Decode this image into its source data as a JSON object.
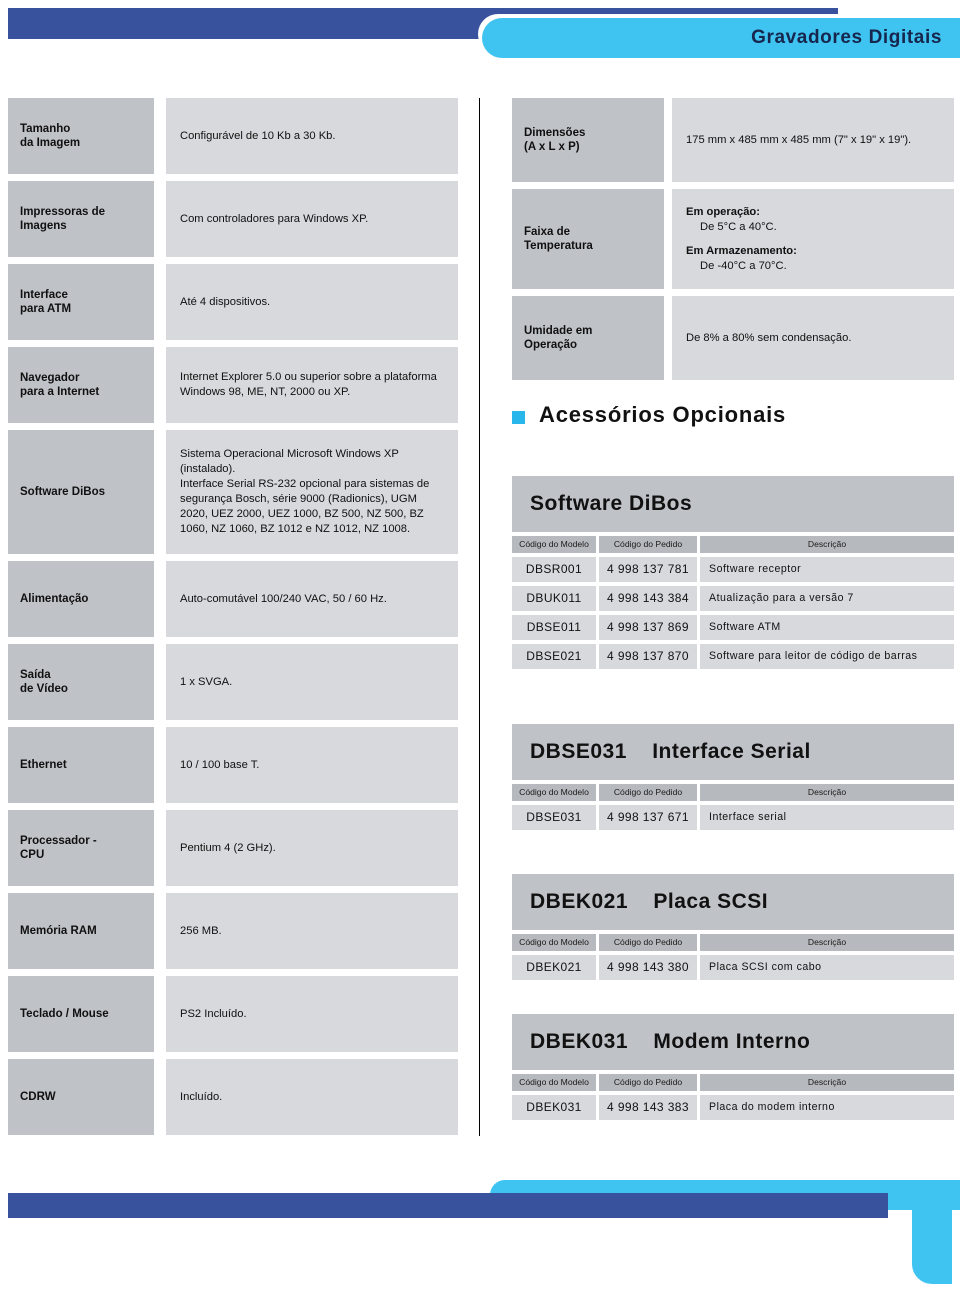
{
  "header": {
    "title": "Gravadores Digitais",
    "accent_dark": "#39529e",
    "accent_light": "#3fc3f0"
  },
  "spec_left": {
    "rows": [
      {
        "label": "Tamanho\nda Imagem",
        "value": "Configurável de 10 Kb a 30 Kb."
      },
      {
        "label": "Impressoras de\nImagens",
        "value": "Com controladores para Windows XP."
      },
      {
        "label": "Interface\npara ATM",
        "value": "Até 4 dispositivos."
      },
      {
        "label": "Navegador\npara a Internet",
        "value": "Internet Explorer 5.0 ou superior sobre a plataforma Windows 98, ME, NT, 2000 ou XP."
      },
      {
        "label": "Software DiBos",
        "value": "Sistema Operacional Microsoft Windows XP (instalado).\nInterface Serial RS-232 opcional para sistemas de segurança Bosch, série 9000 (Radionics), UGM 2020, UEZ 2000, UEZ 1000, BZ 500, NZ 500, BZ 1060, NZ 1060, BZ 1012 e NZ 1012, NZ 1008."
      },
      {
        "label": "Alimentação",
        "value": "Auto-comutável 100/240 VAC, 50 / 60 Hz."
      },
      {
        "label": "Saída\nde Vídeo",
        "value": "1 x SVGA."
      },
      {
        "label": "Ethernet",
        "value": "10 / 100 base T."
      },
      {
        "label": "Processador -\nCPU",
        "value": "Pentium 4 (2 GHz)."
      },
      {
        "label": "Memória RAM",
        "value": "256 MB."
      },
      {
        "label": "Teclado / Mouse",
        "value": "PS2 Incluído."
      },
      {
        "label": "CDRW",
        "value": "Incluído."
      }
    ]
  },
  "spec_right": {
    "rows": [
      {
        "label": "Dimensões\n(A x L x P)",
        "value": "175 mm x 485 mm x 485 mm (7\" x 19\" x 19\")."
      },
      {
        "label": "Faixa de\nTemperatura",
        "value": "",
        "lines": [
          {
            "bold": "Em operação:",
            "rest": " De 5°C a 40°C."
          },
          {
            "bold": "Em Armazenamento:",
            "rest": " De -40°C a 70°C."
          }
        ]
      },
      {
        "label": "Umidade em\nOperação",
        "value": "De 8% a 80% sem condensação."
      }
    ]
  },
  "accessories": {
    "heading": "Acessórios Opcionais",
    "bullet_color": "#29b6ea",
    "column_headers": [
      "Código do Modelo",
      "Código do Pedido",
      "Descrição"
    ],
    "blocks": [
      {
        "title": "Software DiBos",
        "rows": [
          {
            "model": "DBSR001",
            "order": "4 998 137 781",
            "description": "Software receptor"
          },
          {
            "model": "DBUK011",
            "order": "4 998 143 384",
            "description": "Atualização para a versão 7"
          },
          {
            "model": "DBSE011",
            "order": "4 998 137 869",
            "description": "Software ATM"
          },
          {
            "model": "DBSE021",
            "order": "4 998 137 870",
            "description": "Software para leitor de código de barras"
          }
        ]
      },
      {
        "title": "DBSE031    Interface Serial",
        "rows": [
          {
            "model": "DBSE031",
            "order": "4 998 137 671",
            "description": "Interface serial"
          }
        ]
      },
      {
        "title": "DBEK021    Placa SCSI",
        "rows": [
          {
            "model": "DBEK021",
            "order": "4 998 143 380",
            "description": "Placa SCSI com cabo"
          }
        ]
      },
      {
        "title": "DBEK031    Modem Interno",
        "rows": [
          {
            "model": "DBEK031",
            "order": "4 998 143 383",
            "description": "Placa do modem interno"
          }
        ]
      }
    ]
  }
}
